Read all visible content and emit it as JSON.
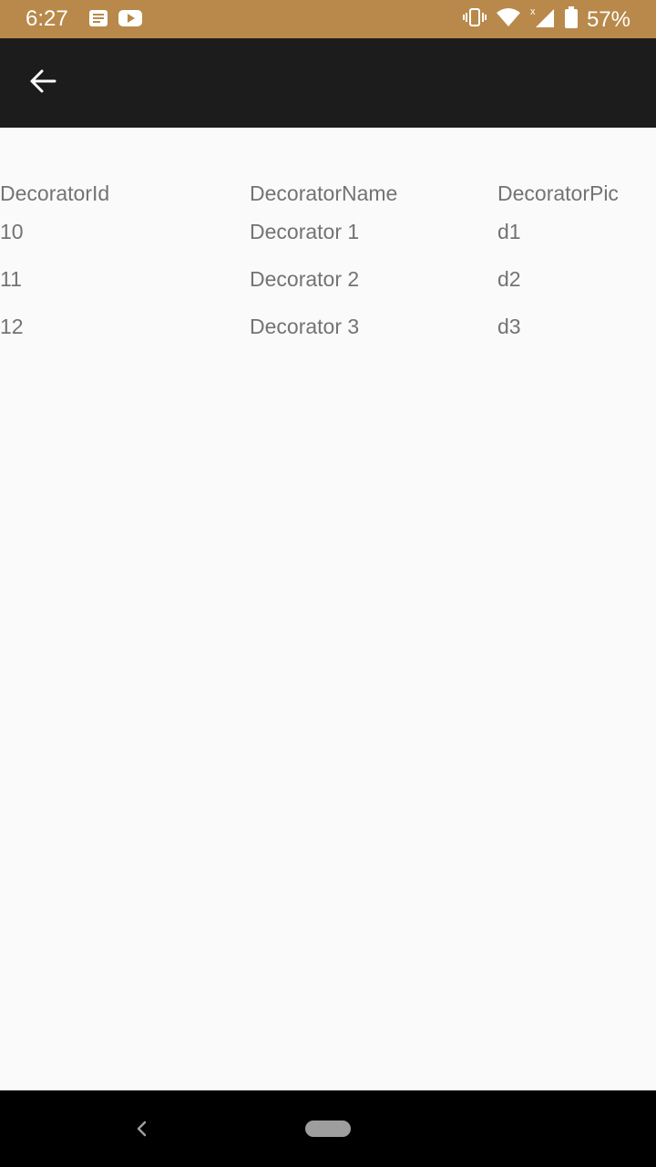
{
  "status_bar": {
    "time": "6:27",
    "battery": "57%",
    "icons_left": [
      "message-icon",
      "youtube-icon"
    ],
    "icons_right": [
      "vibrate-icon",
      "wifi-icon",
      "signal-icon",
      "battery-icon"
    ],
    "background": "#b8894a"
  },
  "app_bar": {
    "back_icon": "arrow-left-icon",
    "background": "#1c1c1c"
  },
  "table": {
    "columns": [
      "DecoratorId",
      "DecoratorName",
      "DecoratorPic"
    ],
    "rows": [
      [
        "10",
        "Decorator 1",
        "d1"
      ],
      [
        "11",
        "Decorator 2",
        "d2"
      ],
      [
        "12",
        "Decorator 3",
        "d3"
      ]
    ]
  },
  "nav_bar": {
    "back_icon": "chevron-left-icon",
    "home_icon": "home-pill-icon"
  }
}
